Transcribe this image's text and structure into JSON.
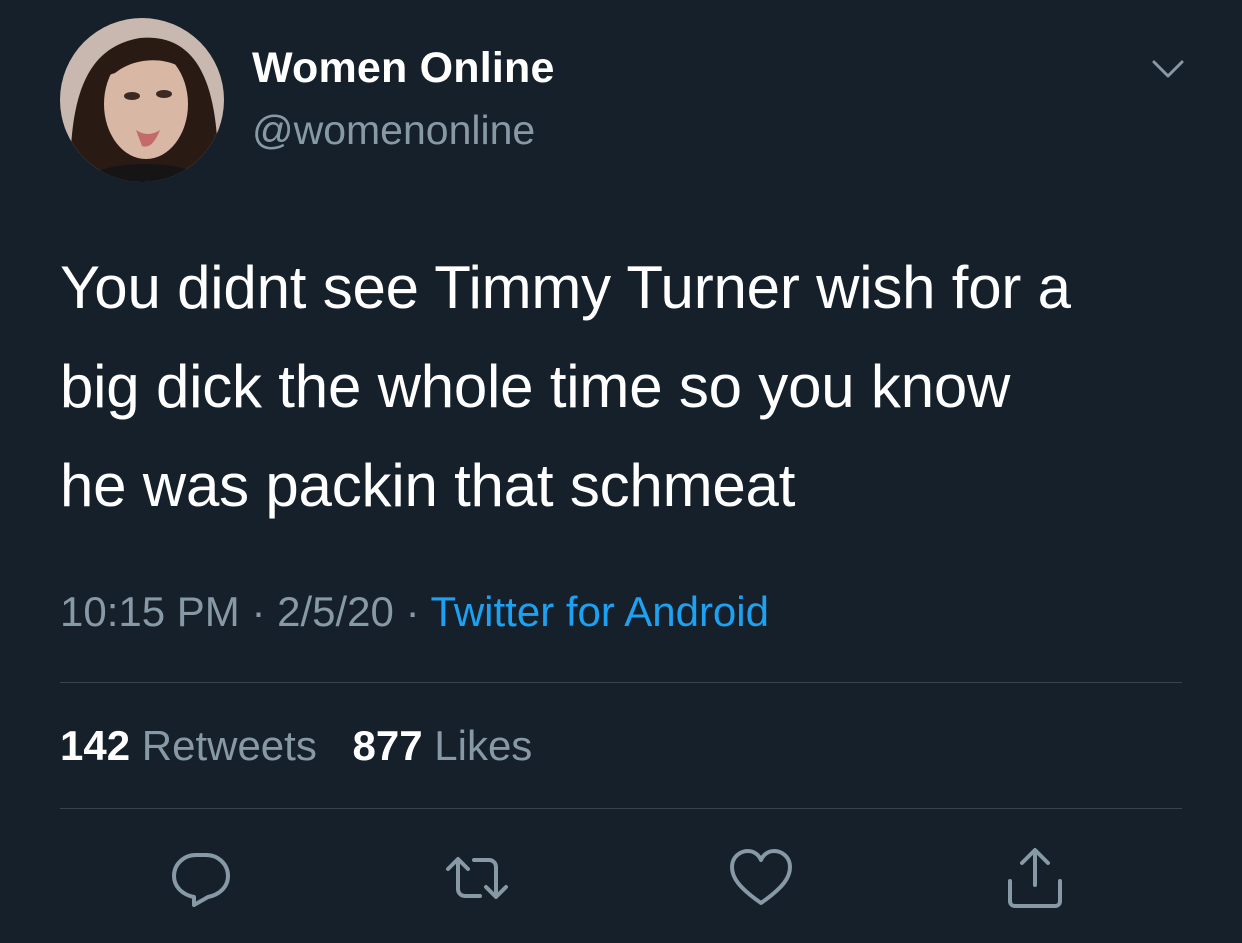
{
  "author": {
    "display_name": "Women Online",
    "handle": "@womenonline"
  },
  "tweet": {
    "lines": [
      "You didnt see Timmy Turner wish for a",
      "big dick the whole time so you know",
      "he was packin that schmeat"
    ],
    "time": "10:15 PM",
    "date": "2/5/20",
    "separator": "·",
    "source": "Twitter for Android"
  },
  "stats": {
    "retweets_count": "142",
    "retweets_label": "Retweets",
    "likes_count": "877",
    "likes_label": "Likes"
  },
  "colors": {
    "background": "#15202b",
    "primary_text": "#ffffff",
    "secondary_text": "#8899a6",
    "accent": "#1da1f2",
    "divider": "#38444d"
  },
  "icons": {
    "caret": "chevron-down-icon",
    "reply": "reply-icon",
    "retweet": "retweet-icon",
    "like": "heart-icon",
    "share": "share-icon"
  }
}
